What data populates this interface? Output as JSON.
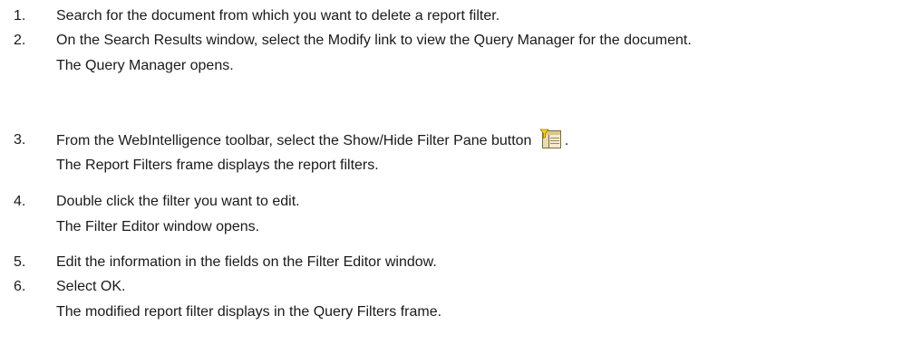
{
  "steps": [
    {
      "number": "1.",
      "text": "Search for the document from which you want to delete a report filter."
    },
    {
      "number": "2.",
      "text": "On the Search Results window, select the Modify link to view the Query Manager for the document.",
      "result": "The Query Manager opens."
    },
    {
      "number": "3.",
      "text": "From the WebIntelligence toolbar, select the Show/Hide Filter Pane button",
      "icon": "filter-pane-icon",
      "text_after_icon": ".",
      "result": "The Report Filters frame displays the report filters."
    },
    {
      "number": "4.",
      "text": "Double click the filter you want to edit.",
      "result": "The Filter Editor window opens."
    },
    {
      "number": "5.",
      "text": "Edit the information in the fields on the Filter Editor window."
    },
    {
      "number": "6.",
      "text": "Select OK.",
      "result": "The modified report filter displays in the Query Filters frame."
    }
  ]
}
